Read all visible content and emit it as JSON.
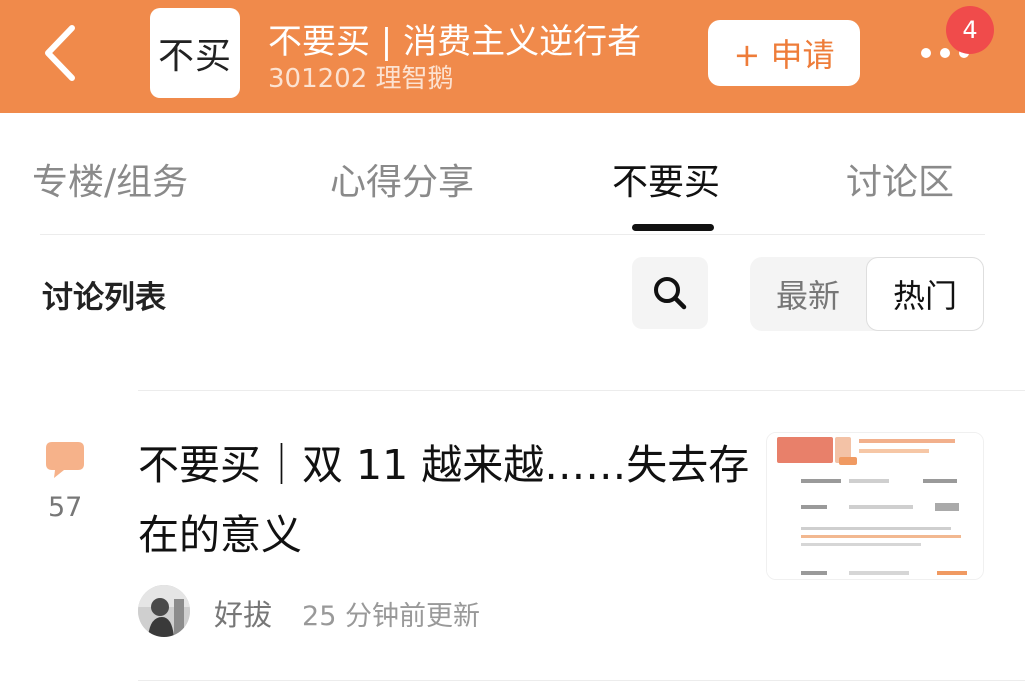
{
  "header": {
    "logo_text": "不买",
    "title": "不要买 | 消费主义逆行者",
    "subtitle": "301202 理智鹅",
    "apply_label": "+ 申请",
    "notification_count": "4",
    "accent_color": "#f08a4b"
  },
  "tabs": [
    {
      "label": "专楼/组务",
      "active": false
    },
    {
      "label": "心得分享",
      "active": false
    },
    {
      "label": "不要买",
      "active": true
    },
    {
      "label": "讨论区",
      "active": false
    }
  ],
  "toolbar": {
    "title": "讨论列表",
    "sort_options": [
      "最新",
      "热门"
    ],
    "selected_sort": "热门"
  },
  "post": {
    "comment_count": "57",
    "title": "不要买｜双 11 越来越……失去存在的意义",
    "author": "好拔",
    "updated": "25 分钟前更新"
  }
}
